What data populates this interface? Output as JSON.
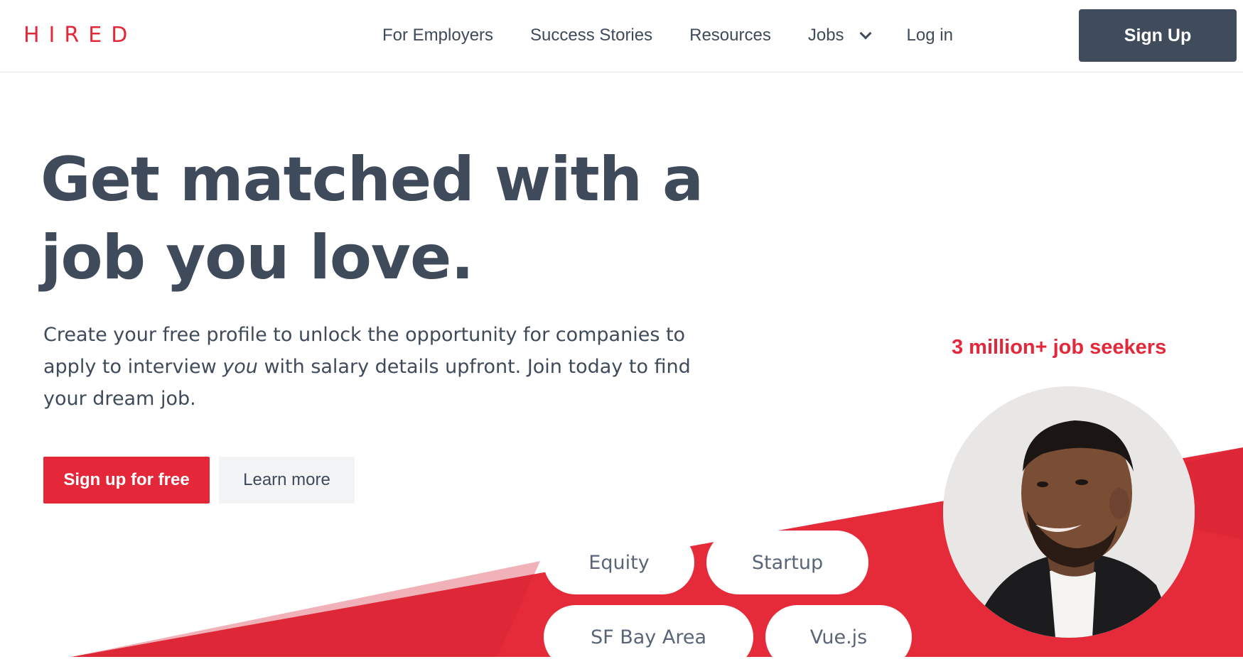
{
  "header": {
    "logo": "HIRED",
    "nav": [
      {
        "label": "For Employers"
      },
      {
        "label": "Success Stories"
      },
      {
        "label": "Resources"
      },
      {
        "label": "Jobs"
      },
      {
        "label": "Log in"
      }
    ],
    "signup_label": "Sign Up"
  },
  "hero": {
    "title_line1": "Get matched with a",
    "title_line2": "job you love.",
    "subtitle_part1": "Create your free profile to unlock the opportunity for companies to apply to interview ",
    "subtitle_emphasis": "you",
    "subtitle_part2": " with salary details upfront. Join today to find your dream job.",
    "cta_primary": "Sign up for free",
    "cta_secondary": "Learn more"
  },
  "social_proof": {
    "seekers_label": "3 million+ job seekers"
  },
  "tags": [
    "Equity",
    "Startup",
    "SF Bay Area",
    "Vue.js"
  ],
  "colors": {
    "brand_red": "#e4283a",
    "slate": "#3f4a5a",
    "button_dark": "#404b5c"
  },
  "icons": {
    "jobs_dropdown": "chevron-down-icon"
  }
}
